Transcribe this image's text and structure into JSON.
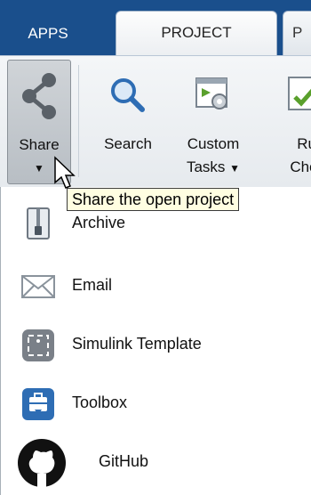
{
  "tabs": {
    "apps": "APPS",
    "project": "PROJECT",
    "next": "P"
  },
  "toolstrip": {
    "share": {
      "label": "Share",
      "icon": "share-icon"
    },
    "search": {
      "label": "Search",
      "icon": "search-icon"
    },
    "custom_tasks": {
      "label_line1": "Custom",
      "label_line2": "Tasks",
      "icon": "custom-tasks-icon"
    },
    "run_checks": {
      "label_line1": "Ru",
      "label_line2": "Chec",
      "icon": "run-checks-icon"
    }
  },
  "tooltip": "Share the open project",
  "menu": {
    "items": [
      {
        "label": "Archive",
        "icon": "archive-icon"
      },
      {
        "label": "Email",
        "icon": "email-icon"
      },
      {
        "label": "Simulink Template",
        "icon": "simulink-template-icon"
      },
      {
        "label": "Toolbox",
        "icon": "toolbox-icon"
      },
      {
        "label": "GitHub",
        "icon": "github-icon"
      }
    ]
  },
  "colors": {
    "tab_strip": "#1a4f8c",
    "share_pressed": "#c0c6cc",
    "tooltip_bg": "#fffee1",
    "toolbox_blue": "#2e6db4"
  }
}
